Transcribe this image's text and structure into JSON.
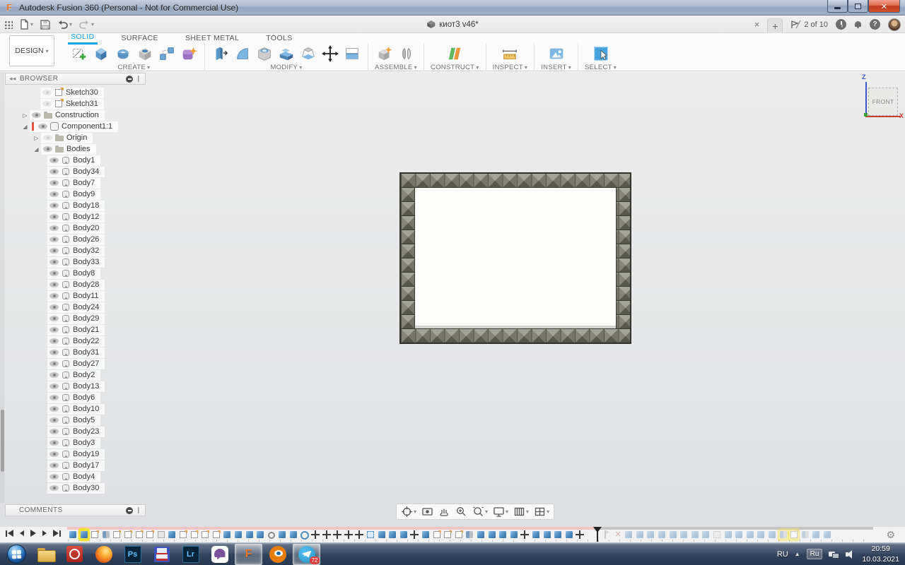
{
  "window": {
    "title": "Autodesk Fusion 360 (Personal - Not for Commercial Use)"
  },
  "doc": {
    "title": "киот3 v46*"
  },
  "status": {
    "job": "2 of 10"
  },
  "qat": {
    "icons": [
      "app-launcher-grid",
      "file-menu",
      "save",
      "undo",
      "redo"
    ]
  },
  "top_right": {
    "icons": [
      "close-document-tab",
      "new-document-tab",
      "job-status-flag",
      "recent-clock",
      "notifications-bell",
      "help",
      "user-avatar"
    ]
  },
  "ribbon": {
    "design": "DESIGN",
    "tabs": [
      "SOLID",
      "SURFACE",
      "SHEET METAL",
      "TOOLS"
    ],
    "active_tab": "SOLID",
    "groups": [
      {
        "label": "CREATE"
      },
      {
        "label": "MODIFY"
      },
      {
        "label": "ASSEMBLE"
      },
      {
        "label": "CONSTRUCT"
      },
      {
        "label": "INSPECT"
      },
      {
        "label": "INSERT"
      },
      {
        "label": "SELECT"
      }
    ]
  },
  "browser": {
    "title": "BROWSER",
    "rows": [
      {
        "label": "Sketch30",
        "cls": "ind3b eye-off ic-sketch disc-none"
      },
      {
        "label": "Sketch31",
        "cls": "ind3b eye-off ic-sketch disc-none"
      },
      {
        "label": "Construction",
        "cls": "ind2 eye-on ic-folder disc-collapsed"
      },
      {
        "label": "Component1:1",
        "cls": "ind2 eye-on ic-component disc-expanded active"
      },
      {
        "label": "Origin",
        "cls": "ind3 eye-off ic-folder disc-collapsed"
      },
      {
        "label": "Bodies",
        "cls": "ind3 eye-on ic-folder disc-expanded"
      },
      {
        "label": "Body1",
        "cls": "ind4 eye-on ic-body disc-none"
      },
      {
        "label": "Body34",
        "cls": "ind4 eye-on ic-body disc-none"
      },
      {
        "label": "Body7",
        "cls": "ind4 eye-on ic-body disc-none"
      },
      {
        "label": "Body9",
        "cls": "ind4 eye-on ic-body disc-none"
      },
      {
        "label": "Body18",
        "cls": "ind4 eye-on ic-body disc-none"
      },
      {
        "label": "Body12",
        "cls": "ind4 eye-on ic-body disc-none"
      },
      {
        "label": "Body20",
        "cls": "ind4 eye-on ic-body disc-none"
      },
      {
        "label": "Body26",
        "cls": "ind4 eye-on ic-body disc-none"
      },
      {
        "label": "Body32",
        "cls": "ind4 eye-on ic-body disc-none"
      },
      {
        "label": "Body33",
        "cls": "ind4 eye-on ic-body disc-none"
      },
      {
        "label": "Body8",
        "cls": "ind4 eye-on ic-body disc-none"
      },
      {
        "label": "Body28",
        "cls": "ind4 eye-on ic-body disc-none"
      },
      {
        "label": "Body11",
        "cls": "ind4 eye-on ic-body disc-none"
      },
      {
        "label": "Body24",
        "cls": "ind4 eye-on ic-body disc-none"
      },
      {
        "label": "Body29",
        "cls": "ind4 eye-on ic-body disc-none"
      },
      {
        "label": "Body21",
        "cls": "ind4 eye-on ic-body disc-none"
      },
      {
        "label": "Body22",
        "cls": "ind4 eye-on ic-body disc-none"
      },
      {
        "label": "Body31",
        "cls": "ind4 eye-on ic-body disc-none"
      },
      {
        "label": "Body27",
        "cls": "ind4 eye-on ic-body disc-none"
      },
      {
        "label": "Body2",
        "cls": "ind4 eye-on ic-body disc-none"
      },
      {
        "label": "Body13",
        "cls": "ind4 eye-on ic-body disc-none"
      },
      {
        "label": "Body6",
        "cls": "ind4 eye-on ic-body disc-none"
      },
      {
        "label": "Body10",
        "cls": "ind4 eye-on ic-body disc-none"
      },
      {
        "label": "Body5",
        "cls": "ind4 eye-on ic-body disc-none"
      },
      {
        "label": "Body23",
        "cls": "ind4 eye-on ic-body disc-none"
      },
      {
        "label": "Body3",
        "cls": "ind4 eye-on ic-body disc-none"
      },
      {
        "label": "Body19",
        "cls": "ind4 eye-on ic-body disc-none"
      },
      {
        "label": "Body17",
        "cls": "ind4 eye-on ic-body disc-none"
      },
      {
        "label": "Body4",
        "cls": "ind4 eye-on ic-body disc-none"
      },
      {
        "label": "Body30",
        "cls": "ind4 eye-on ic-body disc-none"
      }
    ]
  },
  "comments": {
    "title": "COMMENTS"
  },
  "viewcube": {
    "face": "FRONT",
    "axis_z": "Z",
    "axis_x": "X"
  },
  "nav_bar": {
    "icons": [
      "orbit",
      "look-at",
      "pan",
      "zoom",
      "fit",
      "display-settings",
      "grid-display",
      "viewports"
    ]
  },
  "timeline": {
    "active": [
      "ft-extrude",
      "ft-extrude hl",
      "ft-sketch",
      "ft-form",
      "ft-sketch",
      "ft-sketch",
      "ft-sketch",
      "ft-sketch",
      "ft-boxo",
      "ft-extrude",
      "ft-sketch",
      "ft-sketch",
      "ft-sketch",
      "ft-sketch",
      "ft-extrude",
      "ft-extrude",
      "ft-extrude",
      "ft-extrude",
      "ft-pin",
      "ft-extrude",
      "ft-extrude",
      "ft-revolve",
      "ft-move",
      "ft-move",
      "ft-move",
      "ft-move",
      "ft-move",
      "ft-select",
      "ft-extrude",
      "ft-extrude",
      "ft-extrude",
      "ft-move",
      "ft-extrude",
      "ft-sketch",
      "ft-sketch",
      "ft-sketch",
      "ft-form",
      "ft-extrude",
      "ft-extrude",
      "ft-extrude",
      "ft-extrude",
      "ft-move",
      "ft-extrude",
      "ft-extrude",
      "ft-extrude",
      "ft-extrude",
      "ft-move"
    ],
    "faded": [
      "ft-flag faded",
      "ft-sup faded",
      "ft-extrude faded",
      "ft-extrude faded",
      "ft-extrude faded",
      "ft-extrude faded",
      "ft-extrude faded",
      "ft-extrude faded",
      "ft-extrude faded",
      "ft-extrude faded",
      "ft-boxo faded",
      "ft-extrude faded",
      "ft-extrude faded",
      "ft-extrude faded",
      "ft-extrude faded",
      "ft-extrude faded",
      "ft-form faded hl",
      "ft-sketch faded hl",
      "ft-form faded",
      "ft-extrude faded",
      "ft-extrude faded"
    ]
  },
  "taskbar": {
    "apps": [
      "start",
      "file-explorer",
      "screen-capture",
      "firefox",
      "photoshop",
      "floppy-tool",
      "lightroom",
      "viber",
      "fusion-360",
      "blender",
      "telegram"
    ],
    "labels": {
      "photoshop": "Ps",
      "lightroom": "Lr",
      "fusion": "F"
    },
    "telegram_badge": "72",
    "tray": {
      "lang": "RU",
      "layout": "Ru",
      "time": "20:59",
      "date": "10.03.2021"
    }
  }
}
